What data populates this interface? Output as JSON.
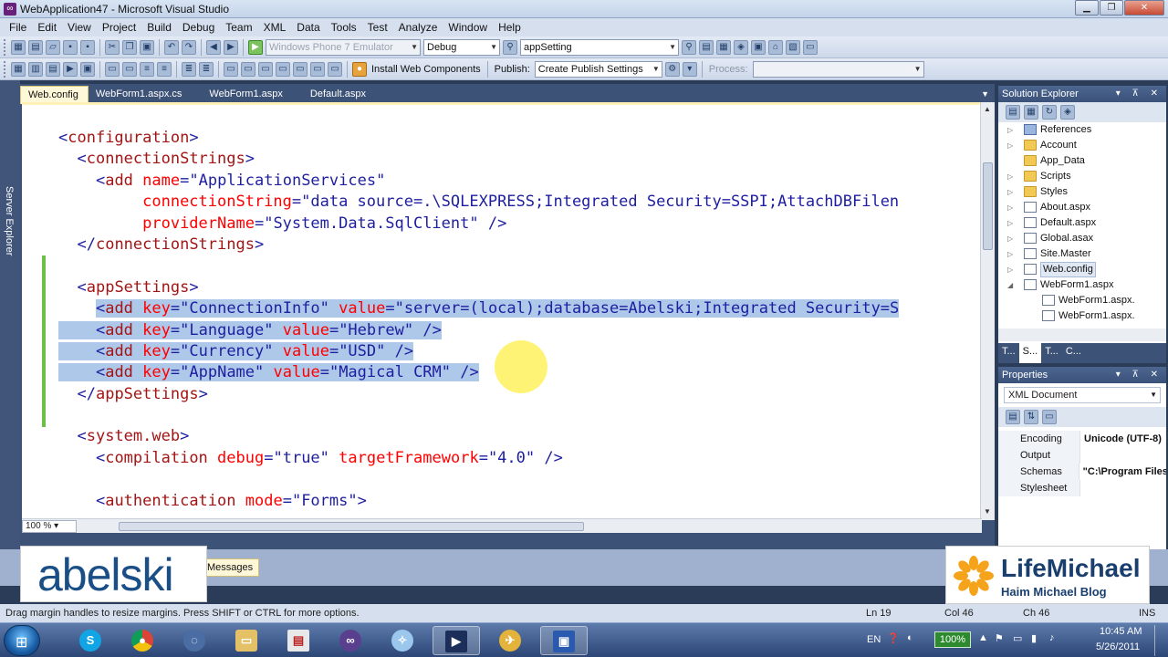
{
  "window": {
    "title": "WebApplication47 - Microsoft Visual Studio",
    "buttons": [
      "▁",
      "❐",
      "✕"
    ]
  },
  "menu": [
    "File",
    "Edit",
    "View",
    "Project",
    "Build",
    "Debug",
    "Team",
    "XML",
    "Data",
    "Tools",
    "Test",
    "Analyze",
    "Window",
    "Help"
  ],
  "toolbar1": {
    "target_platform": "Windows Phone 7 Emulator",
    "configuration": "Debug",
    "find_combo": "appSetting"
  },
  "toolbar2": {
    "install_label": "Install Web Components",
    "publish_label": "Publish:",
    "publish_combo": "Create Publish Settings",
    "process_label": "Process:"
  },
  "left_strip_label": "Server Explorer",
  "editor": {
    "tabs": [
      "Web.config",
      "WebForm1.aspx.cs",
      "WebForm1.aspx",
      "Default.aspx"
    ],
    "active_tab": "Web.config",
    "zoom": "100 %",
    "lines": [
      "<configuration>",
      "  <connectionStrings>",
      "    <add name=\"ApplicationServices\"",
      "         connectionString=\"data source=.\\SQLEXPRESS;Integrated Security=SSPI;AttachDBFilen",
      "         providerName=\"System.Data.SqlClient\" />",
      "  </connectionStrings>",
      "",
      "  <appSettings>",
      "    <add key=\"ConnectionInfo\" value=\"server=(local);database=Abelski;Integrated Security=S",
      "    <add key=\"Language\" value=\"Hebrew\" />",
      "    <add key=\"Currency\" value=\"USD\" />",
      "    <add key=\"AppName\" value=\"Magical CRM\" />",
      "  </appSettings>",
      "",
      "  <system.web>",
      "    <compilation debug=\"true\" targetFramework=\"4.0\" />",
      "",
      "    <authentication mode=\"Forms\">"
    ]
  },
  "solution_explorer": {
    "title": "Solution Explorer",
    "items": [
      {
        "label": "References",
        "type": "ref",
        "indent": 1,
        "exp": "▷"
      },
      {
        "label": "Account",
        "type": "folder",
        "indent": 1,
        "exp": "▷"
      },
      {
        "label": "App_Data",
        "type": "folder",
        "indent": 1,
        "exp": ""
      },
      {
        "label": "Scripts",
        "type": "folder",
        "indent": 1,
        "exp": "▷"
      },
      {
        "label": "Styles",
        "type": "folder",
        "indent": 1,
        "exp": "▷"
      },
      {
        "label": "About.aspx",
        "type": "file",
        "indent": 1,
        "exp": "▷"
      },
      {
        "label": "Default.aspx",
        "type": "file",
        "indent": 1,
        "exp": "▷"
      },
      {
        "label": "Global.asax",
        "type": "file",
        "indent": 1,
        "exp": "▷"
      },
      {
        "label": "Site.Master",
        "type": "file",
        "indent": 1,
        "exp": "▷"
      },
      {
        "label": "Web.config",
        "type": "file",
        "indent": 1,
        "exp": "▷",
        "selected": true
      },
      {
        "label": "WebForm1.aspx",
        "type": "file",
        "indent": 1,
        "exp": "◢"
      },
      {
        "label": "WebForm1.aspx.",
        "type": "file",
        "indent": 2,
        "exp": ""
      },
      {
        "label": "WebForm1.aspx.",
        "type": "file",
        "indent": 2,
        "exp": ""
      }
    ],
    "bottom_tabs": [
      "T...",
      "S...",
      "T...",
      "C..."
    ]
  },
  "properties": {
    "title": "Properties",
    "object": "XML Document",
    "rows": [
      {
        "name": "Encoding",
        "value": "Unicode (UTF-8)"
      },
      {
        "name": "Output",
        "value": ""
      },
      {
        "name": "Schemas",
        "value": "\"C:\\Program Files"
      },
      {
        "name": "Stylesheet",
        "value": ""
      }
    ]
  },
  "output_tabs": [
    "Messages"
  ],
  "watermarks": {
    "left": "abelski",
    "right_title": "LifeMichael",
    "right_subtitle": "Haim Michael Blog"
  },
  "statusbar": {
    "message": "Drag margin handles to resize margins. Press SHIFT or CTRL for more options.",
    "ln": "Ln 19",
    "col": "Col 46",
    "ch": "Ch 46",
    "mode": "INS"
  },
  "taskbar": {
    "lang": "EN",
    "battery": "100%",
    "time": "10:45 AM",
    "date": "5/26/2011"
  }
}
